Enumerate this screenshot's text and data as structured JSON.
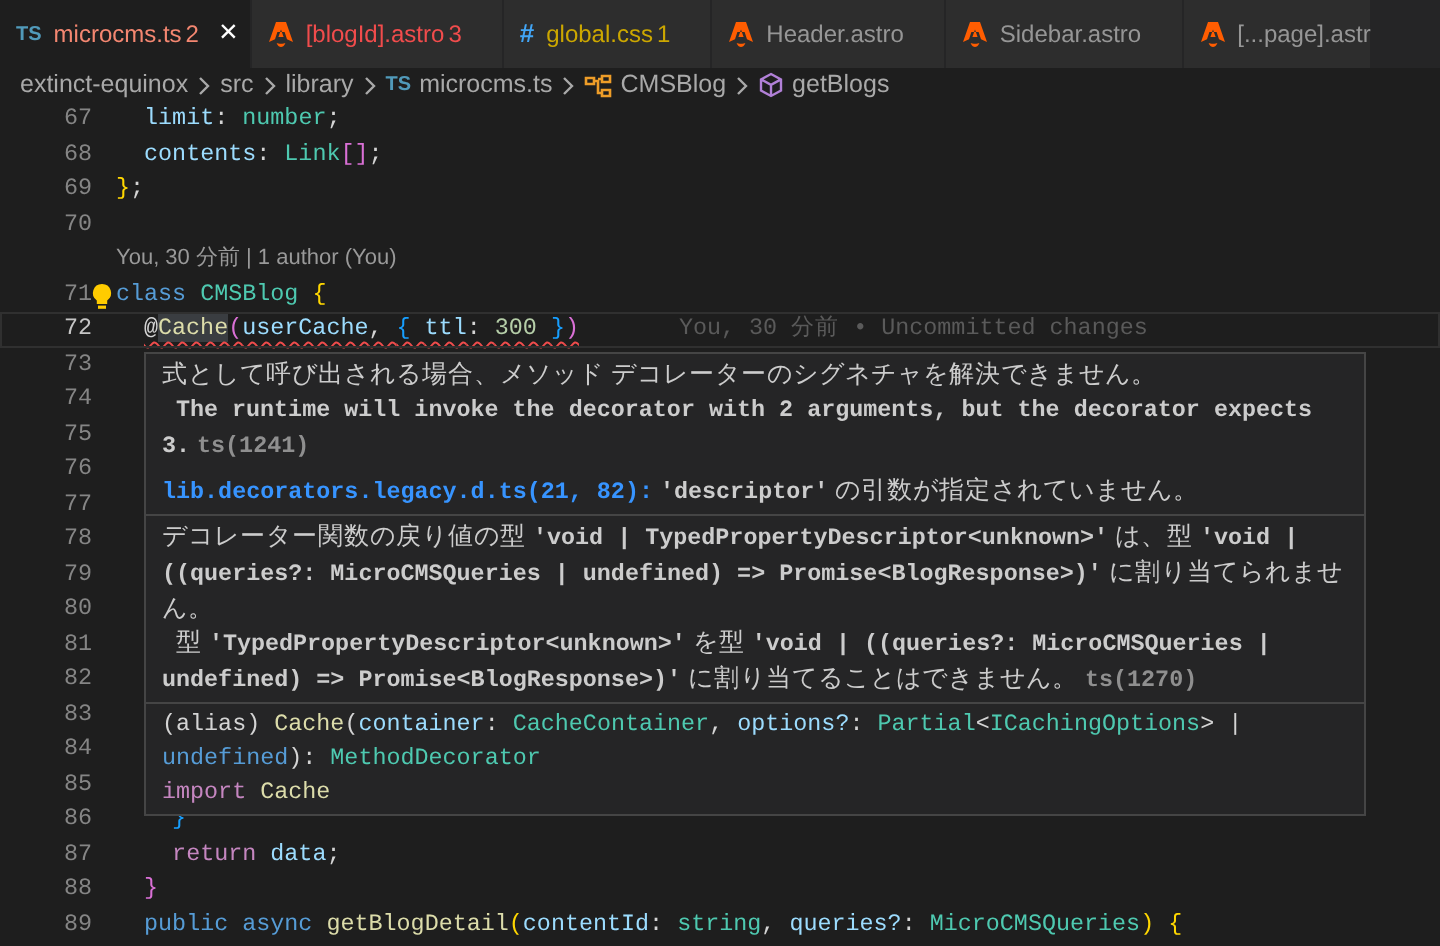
{
  "tabs": [
    {
      "kind": "ts",
      "icon_text": "TS",
      "label": "microcms.ts",
      "color": "#f48771",
      "count": "2",
      "selected": true,
      "close": "×"
    },
    {
      "kind": "astro",
      "label": "[blogId].astro",
      "color": "#f14c4c",
      "count": "3",
      "selected": false
    },
    {
      "kind": "css",
      "icon_text": "#",
      "label": "global.css",
      "color": "#cca700",
      "count": "1",
      "selected": false
    },
    {
      "kind": "astro",
      "label": "Header.astro",
      "color": "#969696",
      "selected": false
    },
    {
      "kind": "astro",
      "label": "Sidebar.astro",
      "color": "#969696",
      "selected": false
    },
    {
      "kind": "astro",
      "label": "[...page].astr",
      "color": "#969696",
      "selected": false
    }
  ],
  "breadcrumb": [
    {
      "kind": "folder",
      "label": "extinct-equinox"
    },
    {
      "kind": "folder",
      "label": "src"
    },
    {
      "kind": "folder",
      "label": "library"
    },
    {
      "kind": "file",
      "icon_text": "TS",
      "label": "microcms.ts"
    },
    {
      "kind": "class",
      "label": "CMSBlog"
    },
    {
      "kind": "method",
      "label": "getBlogs"
    }
  ],
  "editor": {
    "rows": [
      {
        "kind": "code",
        "number": "67",
        "current": false,
        "tokens": [
          {
            "kind": "prop",
            "text": "  limit"
          },
          {
            "kind": "punct",
            "text": ": "
          },
          {
            "kind": "type",
            "text": "number"
          },
          {
            "kind": "punct",
            "text": ";"
          }
        ]
      },
      {
        "kind": "code",
        "number": "68",
        "current": false,
        "tokens": [
          {
            "kind": "prop",
            "text": "  contents"
          },
          {
            "kind": "punct",
            "text": ": "
          },
          {
            "kind": "type",
            "text": "Link"
          },
          {
            "kind": "b2",
            "text": "[]"
          },
          {
            "kind": "punct",
            "text": ";"
          }
        ]
      },
      {
        "kind": "code",
        "number": "69",
        "current": false,
        "tokens": [
          {
            "kind": "b1",
            "text": "}"
          },
          {
            "kind": "punct",
            "text": ";"
          }
        ]
      },
      {
        "kind": "code",
        "number": "70",
        "current": false
      },
      {
        "kind": "codelens",
        "text": "You, 30 分前 | 1 author (You)"
      },
      {
        "kind": "code",
        "number": "71",
        "current": false,
        "lightbulb": true,
        "tokens": [
          {
            "kind": "kw",
            "text": "class "
          },
          {
            "kind": "type",
            "text": "CMSBlog "
          },
          {
            "kind": "b1",
            "text": "{"
          }
        ]
      },
      {
        "kind": "code",
        "number": "72",
        "current": true,
        "error_underline": true,
        "blame": "You, 30 分前 • Uncommitted changes",
        "tokens": [
          {
            "kind": "punct",
            "text": "@"
          },
          {
            "kind": "match",
            "text": "Cache"
          },
          {
            "kind": "b2",
            "text": "("
          },
          {
            "kind": "var",
            "text": "userCache"
          },
          {
            "kind": "punct",
            "text": ", "
          },
          {
            "kind": "b3",
            "text": "{ "
          },
          {
            "kind": "prop",
            "text": "ttl"
          },
          {
            "kind": "punct",
            "text": ": "
          },
          {
            "kind": "num",
            "text": "300 "
          },
          {
            "kind": "b3",
            "text": "}"
          },
          {
            "kind": "b2",
            "text": ")"
          }
        ]
      },
      {
        "kind": "code",
        "number": "73",
        "current": false
      },
      {
        "kind": "code",
        "number": "74",
        "current": false
      },
      {
        "kind": "code",
        "number": "75",
        "current": false
      },
      {
        "kind": "code",
        "number": "76",
        "current": false
      },
      {
        "kind": "code",
        "number": "77",
        "current": false
      },
      {
        "kind": "code",
        "number": "78",
        "current": false
      },
      {
        "kind": "code",
        "number": "79",
        "current": false
      },
      {
        "kind": "code",
        "number": "80",
        "current": false
      },
      {
        "kind": "code",
        "number": "81",
        "current": false
      },
      {
        "kind": "code",
        "number": "82",
        "current": false
      },
      {
        "kind": "code",
        "number": "83",
        "current": false
      },
      {
        "kind": "code",
        "number": "84",
        "current": false
      },
      {
        "kind": "code",
        "number": "85",
        "current": false
      },
      {
        "kind": "code",
        "number": "86",
        "current": false,
        "tokens": [
          {
            "kind": "b3",
            "text": "    }"
          }
        ]
      },
      {
        "kind": "code",
        "number": "87",
        "current": false,
        "tokens": [
          {
            "kind": "ctrl",
            "text": "    return "
          },
          {
            "kind": "var",
            "text": "data"
          },
          {
            "kind": "punct",
            "text": ";"
          }
        ]
      },
      {
        "kind": "code",
        "number": "88",
        "current": false,
        "tokens": [
          {
            "kind": "b2",
            "text": "  }"
          }
        ]
      },
      {
        "kind": "code",
        "number": "89",
        "current": false,
        "tokens": [
          {
            "kind": "kw",
            "text": "  public async "
          },
          {
            "kind": "func",
            "text": "getBlogDetail"
          },
          {
            "kind": "b1",
            "text": "("
          },
          {
            "kind": "var",
            "text": "contentId"
          },
          {
            "kind": "punct",
            "text": ": "
          },
          {
            "kind": "type",
            "text": "string"
          },
          {
            "kind": "punct",
            "text": ", "
          },
          {
            "kind": "var",
            "text": "queries?"
          },
          {
            "kind": "punct",
            "text": ": "
          },
          {
            "kind": "type",
            "text": "MicroCMSQueries"
          },
          {
            "kind": "b1",
            "text": ") {"
          }
        ]
      }
    ]
  },
  "hover": {
    "sections": [
      {
        "kind": "problem",
        "lines": [
          "式として呼び出される場合、メソッド デコレーターのシグネチャを解決できません。",
          "  **The runtime will invoke the decorator with 2 arguments, but the decorator expects 3.**"
        ],
        "code": "ts(1241)",
        "related": {
          "link": "lib.decorators.legacy.d.ts(21, 82):",
          "text": " **'descriptor'** の引数が指定されていません。"
        }
      },
      {
        "kind": "problem",
        "lines": [
          "デコレーター関数の戻り値の型 **'void | TypedPropertyDescriptor<unknown>'** は、型 **'void | ((queries?: MicroCMSQueries | undefined) => Promise<BlogResponse>)'** に割り当てられません。",
          "  型 **'TypedPropertyDescriptor<unknown>'** を型 **'void | ((queries?: MicroCMSQueries | undefined) => Promise<BlogResponse>)'** に割り当てることはできません。"
        ],
        "code": "ts(1270)"
      },
      {
        "kind": "signature",
        "lines": [
          [
            {
              "kind": "punct",
              "text": "(alias) "
            },
            {
              "kind": "func",
              "text": "Cache"
            },
            {
              "kind": "punct",
              "text": "("
            },
            {
              "kind": "var",
              "text": "container"
            },
            {
              "kind": "punct",
              "text": ": "
            },
            {
              "kind": "type",
              "text": "CacheContainer"
            },
            {
              "kind": "punct",
              "text": ", "
            },
            {
              "kind": "var",
              "text": "options?"
            },
            {
              "kind": "punct",
              "text": ": "
            },
            {
              "kind": "type",
              "text": "Partial"
            },
            {
              "kind": "punct",
              "text": "<"
            },
            {
              "kind": "type",
              "text": "ICachingOptions"
            },
            {
              "kind": "punct",
              "text": "> | "
            },
            {
              "kind": "kw",
              "text": "undefined"
            },
            {
              "kind": "punct",
              "text": "): "
            },
            {
              "kind": "type",
              "text": "MethodDecorator"
            }
          ],
          [
            {
              "kind": "ctrl",
              "text": "import "
            },
            {
              "kind": "func",
              "text": "Cache"
            }
          ]
        ]
      }
    ]
  }
}
